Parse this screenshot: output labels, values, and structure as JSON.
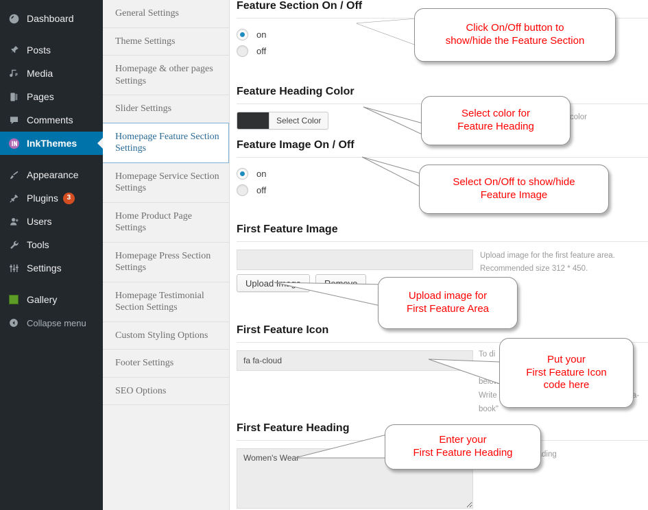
{
  "admin_menu": {
    "items": [
      {
        "label": "Dashboard",
        "icon": "dashboard-icon",
        "current": false
      },
      {
        "label": "Posts",
        "icon": "pin-icon",
        "current": false
      },
      {
        "label": "Media",
        "icon": "media-icon",
        "current": false
      },
      {
        "label": "Pages",
        "icon": "pages-icon",
        "current": false
      },
      {
        "label": "Comments",
        "icon": "comments-icon",
        "current": false
      },
      {
        "label": "InkThemes",
        "icon": "inkthemes-icon",
        "current": true
      },
      {
        "label": "Appearance",
        "icon": "brush-icon",
        "current": false
      },
      {
        "label": "Plugins",
        "icon": "plug-icon",
        "current": false,
        "badge": "3"
      },
      {
        "label": "Users",
        "icon": "users-icon",
        "current": false
      },
      {
        "label": "Tools",
        "icon": "wrench-icon",
        "current": false
      },
      {
        "label": "Settings",
        "icon": "sliders-icon",
        "current": false
      },
      {
        "label": "Gallery",
        "icon": "gallery-icon",
        "current": false
      },
      {
        "label": "Collapse menu",
        "icon": "collapse-arrow-icon",
        "current": false
      }
    ]
  },
  "settings_nav": {
    "items": [
      {
        "label": "General Settings",
        "active": false
      },
      {
        "label": "Theme Settings",
        "active": false
      },
      {
        "label": "Homepage & other pages Settings",
        "active": false
      },
      {
        "label": "Slider Settings",
        "active": false
      },
      {
        "label": "Homepage Feature Section Settings",
        "active": true
      },
      {
        "label": "Homepage Service Section Settings",
        "active": false
      },
      {
        "label": "Home Product Page Settings",
        "active": false
      },
      {
        "label": "Homepage Press Section Settings",
        "active": false
      },
      {
        "label": "Homepage Testimonial Section Settings",
        "active": false
      },
      {
        "label": "Custom Styling Options",
        "active": false
      },
      {
        "label": "Footer Settings",
        "active": false
      },
      {
        "label": "SEO Options",
        "active": false
      }
    ]
  },
  "fields": {
    "feature_section_onoff": {
      "title": "Feature Section On / Off",
      "options": [
        {
          "label": "on",
          "checked": true
        },
        {
          "label": "off",
          "checked": false
        }
      ]
    },
    "feature_heading_color": {
      "title": "Feature Heading Color",
      "button_label": "Select Color",
      "swatch_hex": "#2f3133",
      "hint": "color"
    },
    "feature_image_onoff": {
      "title": "Feature Image On / Off",
      "options": [
        {
          "label": "on",
          "checked": true
        },
        {
          "label": "off",
          "checked": false
        }
      ]
    },
    "first_feature_image": {
      "title": "First Feature Image",
      "value": "",
      "upload_label": "Upload Image",
      "remove_label": "Remove",
      "hint_line1": "Upload image for the first feature area.",
      "hint_line2": "Recommended size 312 * 450."
    },
    "first_feature_icon": {
      "title": "First Feature Icon",
      "value": "fa fa-cloud",
      "hint_line1": "To di",
      "hint_line2": "below",
      "hint_line3": "Write",
      "hint_line3b": "a-",
      "hint_line4": "book\""
    },
    "first_feature_heading": {
      "title": "First Feature Heading",
      "value": "Women's Wear",
      "hint": "eature heading"
    }
  },
  "callouts": [
    {
      "name": "callout-feature-section-onoff",
      "line1": "Click On/Off button to",
      "line2": "show/hide the Feature Section"
    },
    {
      "name": "callout-feature-heading-color",
      "line1": "Select color for",
      "line2": "Feature Heading"
    },
    {
      "name": "callout-feature-image-onoff",
      "line1": "Select On/Off to show/hide",
      "line2": "Feature Image"
    },
    {
      "name": "callout-upload-image",
      "line1": "Upload image for",
      "line2": "First Feature Area"
    },
    {
      "name": "callout-feature-icon",
      "line1": "Put your",
      "line2": "First Feature Icon",
      "line3": "code here"
    },
    {
      "name": "callout-feature-heading",
      "line1": "Enter your",
      "line2": "First Feature Heading"
    }
  ]
}
